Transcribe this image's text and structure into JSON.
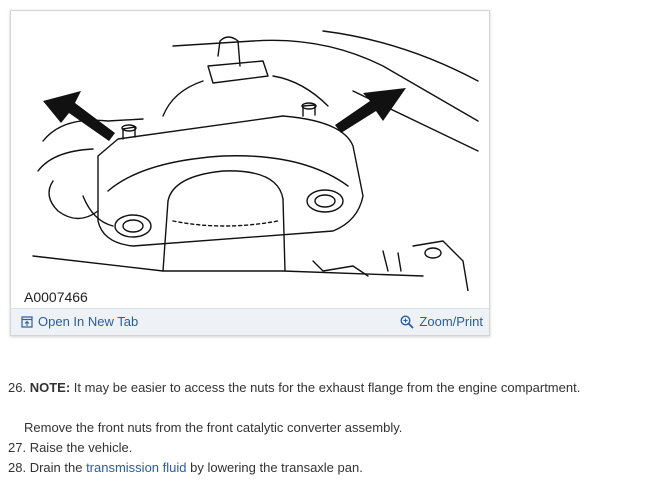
{
  "figure": {
    "id": "A0007466",
    "open_tab_label": "Open In New Tab",
    "zoom_label": "Zoom/Print"
  },
  "steps": [
    {
      "number": "26.",
      "note_label": "NOTE:",
      "note_text": " It may be easier to access the nuts for the exhaust flange from the engine compartment.",
      "sub_text": "Remove the front nuts from the front catalytic converter assembly."
    },
    {
      "number": "27.",
      "text": " Raise the vehicle."
    },
    {
      "number": "28.",
      "text_before": " Drain the ",
      "link_text": "transmission fluid",
      "text_after": " by lowering the transaxle pan."
    }
  ],
  "colors": {
    "link": "#2a5e9c",
    "toolbar_bg": "#eef2f6",
    "text": "#333333"
  }
}
